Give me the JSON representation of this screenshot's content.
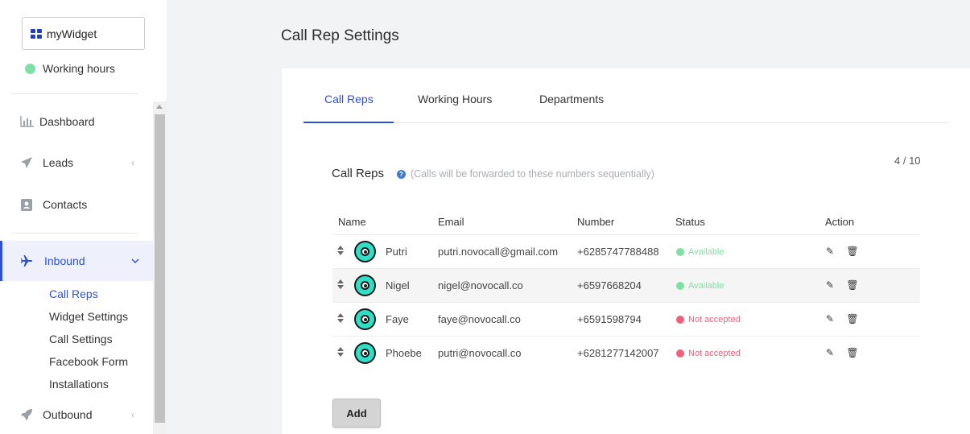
{
  "sidebar": {
    "widget_name": "myWidget",
    "working_hours": "Working hours",
    "nav": {
      "dashboard": "Dashboard",
      "leads": "Leads",
      "contacts": "Contacts",
      "inbound": "Inbound",
      "outbound": "Outbound"
    },
    "inbound_sub": {
      "call_reps": "Call Reps",
      "widget_settings": "Widget Settings",
      "call_settings": "Call Settings",
      "facebook_form": "Facebook Form",
      "installations": "Installations"
    }
  },
  "page": {
    "title": "Call Rep Settings"
  },
  "tabs": [
    "Call Reps",
    "Working Hours",
    "Departments"
  ],
  "section": {
    "title": "Call Reps",
    "hint": "(Calls will be forwarded to these numbers sequentially)",
    "count": "4 / 10"
  },
  "table": {
    "headers": {
      "name": "Name",
      "email": "Email",
      "number": "Number",
      "status": "Status",
      "action": "Action"
    },
    "rows": [
      {
        "name": "Putri",
        "email": "putri.novocall@gmail.com",
        "number": "+6285747788488",
        "status": "Available",
        "status_color": "#7fe0a4"
      },
      {
        "name": "Nigel",
        "email": "nigel@novocall.co",
        "number": "+6597668204",
        "status": "Available",
        "status_color": "#7fe0a4"
      },
      {
        "name": "Faye",
        "email": "faye@novocall.co",
        "number": "+6591598794",
        "status": "Not accepted",
        "status_color": "#f0607a"
      },
      {
        "name": "Phoebe",
        "email": "putri@novocall.co",
        "number": "+6281277142007",
        "status": "Not accepted",
        "status_color": "#f0607a"
      }
    ]
  },
  "add_button": "Add",
  "colors": {
    "accent": "#2e50d6",
    "available": "#7fe0a4",
    "not_accepted": "#f0607a"
  }
}
